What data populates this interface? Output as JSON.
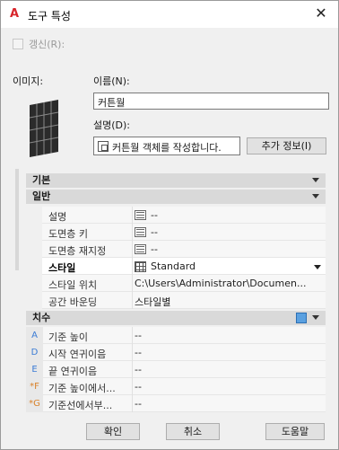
{
  "window": {
    "title": "도구 특성",
    "close_symbol": "✕"
  },
  "refresh": {
    "label": "갱신(R):"
  },
  "image_label": "이미지:",
  "name": {
    "label": "이름(N):",
    "value": "커튼월"
  },
  "description": {
    "label": "설명(D):",
    "value": "커튼월 객체를 작성합니다."
  },
  "more_info_button": "추가 정보(I)",
  "categories": {
    "basic": "기본",
    "general": "일반",
    "dimensions": "치수"
  },
  "general_props": [
    {
      "name": "설명",
      "value": "--"
    },
    {
      "name": "도면층 키",
      "value": "--"
    },
    {
      "name": "도면층 재지정",
      "value": "--"
    },
    {
      "name": "스타일",
      "value": "Standard"
    },
    {
      "name": "스타일 위치",
      "value": "C:\\Users\\Administrator\\Documen..."
    },
    {
      "name": "공간 바운딩",
      "value": "스타일별"
    }
  ],
  "dimension_props": [
    {
      "key": "A",
      "name": "기준 높이",
      "value": "--"
    },
    {
      "key": "D",
      "name": "시작 연귀이음",
      "value": "--"
    },
    {
      "key": "E",
      "name": "끝 연귀이음",
      "value": "--"
    },
    {
      "key": "*F",
      "name": "기준 높이에서...",
      "value": "--"
    },
    {
      "key": "*G",
      "name": "기준선에서부...",
      "value": "--"
    }
  ],
  "buttons": {
    "ok": "확인",
    "cancel": "취소",
    "help": "도움말"
  }
}
